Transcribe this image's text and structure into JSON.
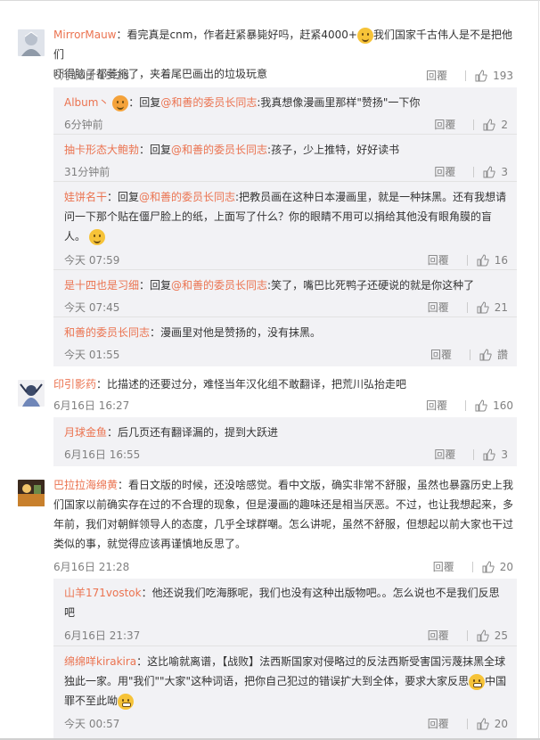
{
  "comments": [
    {
      "user": "MirrorMauw",
      "text": "：看完真是cnm，作者赶紧暴毙好吗，赶紧4000+",
      "text2": "我们国家千古伟人是不是把他们",
      "text3": "吓得脑子都萎缩了，夹着尾巴画出的垃圾玩意",
      "time": "6月16日 15:28",
      "reply": "回覆",
      "likes": "193",
      "replies": [
        {
          "user": "Album丶",
          "prefix": "：回复",
          "mention": "@和善的委员长同志",
          "text": ":我真想像漫画里那样\"赞扬\"一下你",
          "time": "6分钟前",
          "reply": "回覆",
          "likes": "2"
        },
        {
          "user": "抽卡形态大鲍勃",
          "prefix": "：回复",
          "mention": "@和善的委员长同志",
          "text": ":孩子，少上推特，好好读书",
          "time": "31分钟前",
          "reply": "回覆",
          "likes": "3"
        },
        {
          "user": "娃饼名干",
          "prefix": "：回复",
          "mention": "@和善的委员长同志",
          "text": ":把教员画在这种日本漫画里，就是一种抹黑。还有我想请",
          "text2": "问一下那个贴在僵尸脸上的纸，上面写了什么？你的眼睛不用可以捐给其他没有眼角膜的盲",
          "text3": "人。",
          "time": "今天 07:59",
          "reply": "回覆",
          "likes": "16"
        },
        {
          "user": "是十四也是习细",
          "prefix": "：回复",
          "mention": "@和善的委员长同志",
          "text": ":笑了，嘴巴比死鸭子还硬说的就是你这种了",
          "time": "今天 07:45",
          "reply": "回覆",
          "likes": "21"
        },
        {
          "user": "和善的委员长同志",
          "prefix": "：",
          "mention": "",
          "text": "漫画里对他是赞扬的，没有抹黑。",
          "time": "今天 01:55",
          "reply": "回覆",
          "likes": "讚"
        }
      ]
    },
    {
      "user": "印引影药",
      "text": "：比描述的还要过分，难怪当年汉化组不敢翻译，把荒川弘抬走吧",
      "time": "6月16日 16:27",
      "reply": "回覆",
      "likes": "160",
      "replies": [
        {
          "user": "月球金鱼",
          "prefix": "：",
          "mention": "",
          "text": "后几页还有翻译漏的，提到大跃进",
          "time": "6月16日 16:55",
          "reply": "回覆",
          "likes": "3"
        }
      ]
    },
    {
      "user": "巴拉拉海绵黄",
      "text": "：看日文版的时候，还没啥感觉。看中文版，确实非常不舒服，虽然也暴露历史上我",
      "text2": "们国家以前确实存在过的不合理的现象，但是漫画的趣味还是相当厌恶。不过，也让我想起来，多",
      "text3": "年前，我们对朝鲜领导人的态度，几乎全球群嘲。怎么讲呢，虽然不舒服，但想起以前大家也干过",
      "text4": "类似的事，就觉得应该再谨慎地反思了。",
      "time": "6月16日 21:28",
      "reply": "回覆",
      "likes": "20",
      "replies": [
        {
          "user": "山羊171vostok",
          "prefix": "：",
          "mention": "",
          "text": "他还说我们吃海豚呢，我们也没有这种出版物吧。。怎么说也不是我们反思",
          "text2": "吧",
          "time": "6月16日 21:37",
          "reply": "回覆",
          "likes": "25"
        },
        {
          "user": "绵绵咩kirakira",
          "prefix": "：",
          "mention": "",
          "text": "这比喻就离谱，【战败】法西斯国家对侵略过的反法西斯受害国污蔑抹黑全球",
          "text2": "独此一家。用\"我们\"\"大家\"这种词语，把你自己犯过的错误扩大到全体，要求大家反思",
          "text2b": "中国",
          "text3": "罪不至此呦",
          "time": "今天 00:57",
          "reply": "回覆",
          "likes": "20"
        }
      ]
    }
  ],
  "colors": {
    "name": "#eb7350",
    "time": "#808080",
    "box": "#f2f2f5"
  }
}
